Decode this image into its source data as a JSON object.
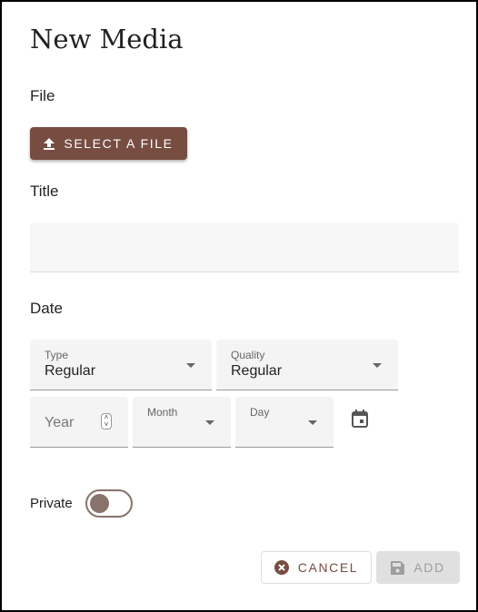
{
  "title": "New Media",
  "file": {
    "label": "File",
    "button": "SELECT A FILE",
    "icon": "upload-icon"
  },
  "title_field": {
    "label": "Title",
    "value": ""
  },
  "date": {
    "label": "Date",
    "type": {
      "label": "Type",
      "value": "Regular"
    },
    "quality": {
      "label": "Quality",
      "value": "Regular"
    },
    "year": {
      "placeholder": "Year"
    },
    "month": {
      "label": "Month"
    },
    "day": {
      "label": "Day"
    }
  },
  "private": {
    "label": "Private",
    "checked": false
  },
  "actions": {
    "cancel": "CANCEL",
    "add": "ADD"
  },
  "colors": {
    "accent": "#774d42",
    "toggle": "#8a726c"
  }
}
